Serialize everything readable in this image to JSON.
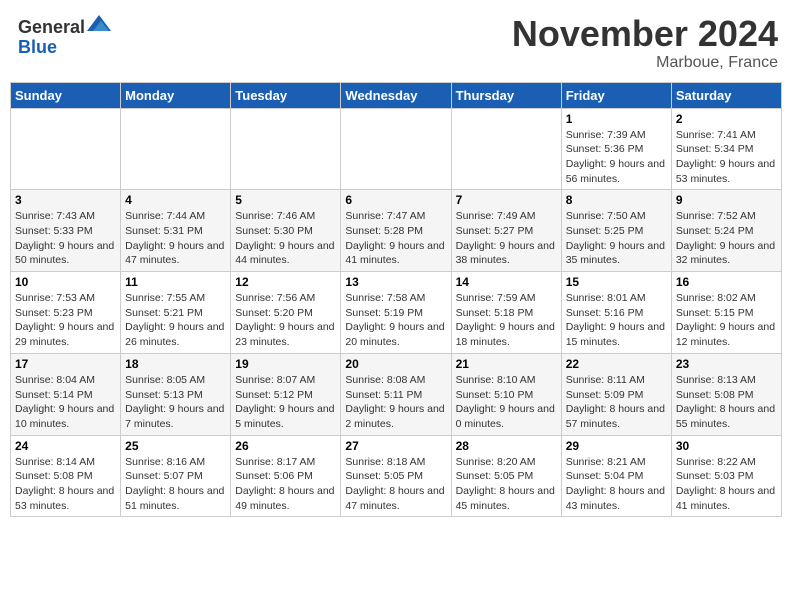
{
  "header": {
    "logo": {
      "general": "General",
      "blue": "Blue"
    },
    "title": "November 2024",
    "location": "Marboue, France"
  },
  "weekdays": [
    "Sunday",
    "Monday",
    "Tuesday",
    "Wednesday",
    "Thursday",
    "Friday",
    "Saturday"
  ],
  "weeks": [
    [
      null,
      null,
      null,
      null,
      null,
      {
        "day": "1",
        "sunrise": "Sunrise: 7:39 AM",
        "sunset": "Sunset: 5:36 PM",
        "daylight": "Daylight: 9 hours and 56 minutes."
      },
      {
        "day": "2",
        "sunrise": "Sunrise: 7:41 AM",
        "sunset": "Sunset: 5:34 PM",
        "daylight": "Daylight: 9 hours and 53 minutes."
      }
    ],
    [
      {
        "day": "3",
        "sunrise": "Sunrise: 7:43 AM",
        "sunset": "Sunset: 5:33 PM",
        "daylight": "Daylight: 9 hours and 50 minutes."
      },
      {
        "day": "4",
        "sunrise": "Sunrise: 7:44 AM",
        "sunset": "Sunset: 5:31 PM",
        "daylight": "Daylight: 9 hours and 47 minutes."
      },
      {
        "day": "5",
        "sunrise": "Sunrise: 7:46 AM",
        "sunset": "Sunset: 5:30 PM",
        "daylight": "Daylight: 9 hours and 44 minutes."
      },
      {
        "day": "6",
        "sunrise": "Sunrise: 7:47 AM",
        "sunset": "Sunset: 5:28 PM",
        "daylight": "Daylight: 9 hours and 41 minutes."
      },
      {
        "day": "7",
        "sunrise": "Sunrise: 7:49 AM",
        "sunset": "Sunset: 5:27 PM",
        "daylight": "Daylight: 9 hours and 38 minutes."
      },
      {
        "day": "8",
        "sunrise": "Sunrise: 7:50 AM",
        "sunset": "Sunset: 5:25 PM",
        "daylight": "Daylight: 9 hours and 35 minutes."
      },
      {
        "day": "9",
        "sunrise": "Sunrise: 7:52 AM",
        "sunset": "Sunset: 5:24 PM",
        "daylight": "Daylight: 9 hours and 32 minutes."
      }
    ],
    [
      {
        "day": "10",
        "sunrise": "Sunrise: 7:53 AM",
        "sunset": "Sunset: 5:23 PM",
        "daylight": "Daylight: 9 hours and 29 minutes."
      },
      {
        "day": "11",
        "sunrise": "Sunrise: 7:55 AM",
        "sunset": "Sunset: 5:21 PM",
        "daylight": "Daylight: 9 hours and 26 minutes."
      },
      {
        "day": "12",
        "sunrise": "Sunrise: 7:56 AM",
        "sunset": "Sunset: 5:20 PM",
        "daylight": "Daylight: 9 hours and 23 minutes."
      },
      {
        "day": "13",
        "sunrise": "Sunrise: 7:58 AM",
        "sunset": "Sunset: 5:19 PM",
        "daylight": "Daylight: 9 hours and 20 minutes."
      },
      {
        "day": "14",
        "sunrise": "Sunrise: 7:59 AM",
        "sunset": "Sunset: 5:18 PM",
        "daylight": "Daylight: 9 hours and 18 minutes."
      },
      {
        "day": "15",
        "sunrise": "Sunrise: 8:01 AM",
        "sunset": "Sunset: 5:16 PM",
        "daylight": "Daylight: 9 hours and 15 minutes."
      },
      {
        "day": "16",
        "sunrise": "Sunrise: 8:02 AM",
        "sunset": "Sunset: 5:15 PM",
        "daylight": "Daylight: 9 hours and 12 minutes."
      }
    ],
    [
      {
        "day": "17",
        "sunrise": "Sunrise: 8:04 AM",
        "sunset": "Sunset: 5:14 PM",
        "daylight": "Daylight: 9 hours and 10 minutes."
      },
      {
        "day": "18",
        "sunrise": "Sunrise: 8:05 AM",
        "sunset": "Sunset: 5:13 PM",
        "daylight": "Daylight: 9 hours and 7 minutes."
      },
      {
        "day": "19",
        "sunrise": "Sunrise: 8:07 AM",
        "sunset": "Sunset: 5:12 PM",
        "daylight": "Daylight: 9 hours and 5 minutes."
      },
      {
        "day": "20",
        "sunrise": "Sunrise: 8:08 AM",
        "sunset": "Sunset: 5:11 PM",
        "daylight": "Daylight: 9 hours and 2 minutes."
      },
      {
        "day": "21",
        "sunrise": "Sunrise: 8:10 AM",
        "sunset": "Sunset: 5:10 PM",
        "daylight": "Daylight: 9 hours and 0 minutes."
      },
      {
        "day": "22",
        "sunrise": "Sunrise: 8:11 AM",
        "sunset": "Sunset: 5:09 PM",
        "daylight": "Daylight: 8 hours and 57 minutes."
      },
      {
        "day": "23",
        "sunrise": "Sunrise: 8:13 AM",
        "sunset": "Sunset: 5:08 PM",
        "daylight": "Daylight: 8 hours and 55 minutes."
      }
    ],
    [
      {
        "day": "24",
        "sunrise": "Sunrise: 8:14 AM",
        "sunset": "Sunset: 5:08 PM",
        "daylight": "Daylight: 8 hours and 53 minutes."
      },
      {
        "day": "25",
        "sunrise": "Sunrise: 8:16 AM",
        "sunset": "Sunset: 5:07 PM",
        "daylight": "Daylight: 8 hours and 51 minutes."
      },
      {
        "day": "26",
        "sunrise": "Sunrise: 8:17 AM",
        "sunset": "Sunset: 5:06 PM",
        "daylight": "Daylight: 8 hours and 49 minutes."
      },
      {
        "day": "27",
        "sunrise": "Sunrise: 8:18 AM",
        "sunset": "Sunset: 5:05 PM",
        "daylight": "Daylight: 8 hours and 47 minutes."
      },
      {
        "day": "28",
        "sunrise": "Sunrise: 8:20 AM",
        "sunset": "Sunset: 5:05 PM",
        "daylight": "Daylight: 8 hours and 45 minutes."
      },
      {
        "day": "29",
        "sunrise": "Sunrise: 8:21 AM",
        "sunset": "Sunset: 5:04 PM",
        "daylight": "Daylight: 8 hours and 43 minutes."
      },
      {
        "day": "30",
        "sunrise": "Sunrise: 8:22 AM",
        "sunset": "Sunset: 5:03 PM",
        "daylight": "Daylight: 8 hours and 41 minutes."
      }
    ]
  ]
}
